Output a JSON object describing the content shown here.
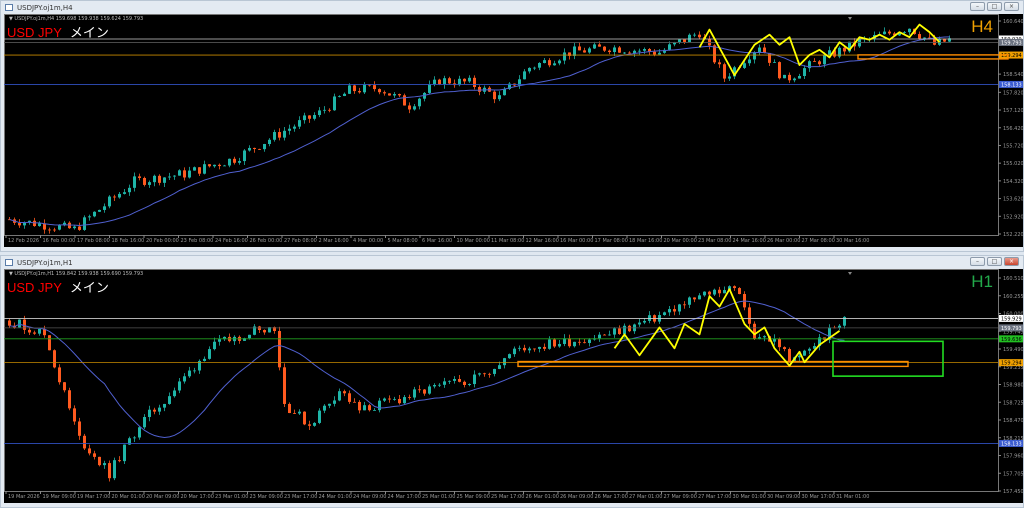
{
  "windows": [
    {
      "title": "USDJPY.oj1m,H4",
      "info": "▼ USDJPY.oj1m,H4  159.698 159.938 159.624 159.793",
      "symbol": "USD JPY",
      "label": "メイン",
      "timeframe": "H4",
      "timeframe_color": "#f0a000",
      "window_buttons": [
        "–",
        "□",
        "×"
      ],
      "price_axis": [
        "160.640",
        "158.540",
        "157.820",
        "157.120",
        "156.420",
        "155.720",
        "155.020",
        "154.320",
        "153.620",
        "152.920",
        "152.220"
      ],
      "price_range": [
        152.22,
        160.64
      ],
      "time_axis": [
        "12 Feb 2026",
        "16 Feb 00:00",
        "17 Feb 08:00",
        "18 Feb 16:00",
        "20 Feb 00:00",
        "23 Feb 08:00",
        "24 Feb 16:00",
        "26 Feb 00:00",
        "27 Feb 08:00",
        "2 Mar 16:00",
        "4 Mar 00:00",
        "5 Mar 08:00",
        "6 Mar 16:00",
        "10 Mar 00:00",
        "11 Mar 08:00",
        "12 Mar 16:00",
        "16 Mar 00:00",
        "17 Mar 08:00",
        "18 Mar 16:00",
        "20 Mar 00:00",
        "23 Mar 08:00",
        "24 Mar 16:00",
        "26 Mar 00:00",
        "27 Mar 08:00",
        "30 Mar 16:00"
      ],
      "hlines": [
        {
          "price": 159.929,
          "label": "159.929",
          "color": "#cccccc",
          "tag_bg": "#ffffff",
          "tag_fg": "#000"
        },
        {
          "price": 159.793,
          "label": "159.793",
          "color": "#555555",
          "tag_bg": "#6b7280",
          "tag_fg": "#fff"
        },
        {
          "price": 159.294,
          "label": "159.294",
          "color": "#c88a00",
          "tag_bg": "#f0a000",
          "tag_fg": "#000"
        },
        {
          "price": 158.133,
          "label": "158.133",
          "color": "#3050c0",
          "tag_bg": "#3a5bd0",
          "tag_fg": "#fff"
        }
      ],
      "price_path": [
        [
          0,
          152.8
        ],
        [
          13,
          152.4
        ],
        [
          25,
          154.3
        ],
        [
          35,
          154.6
        ],
        [
          45,
          155.2
        ],
        [
          55,
          156.3
        ],
        [
          62,
          157.0
        ],
        [
          68,
          157.9
        ],
        [
          74,
          158.0
        ],
        [
          80,
          157.3
        ],
        [
          86,
          158.3
        ],
        [
          92,
          158.2
        ],
        [
          98,
          157.6
        ],
        [
          104,
          158.8
        ],
        [
          112,
          159.4
        ],
        [
          120,
          159.6
        ],
        [
          130,
          159.4
        ],
        [
          138,
          160.2
        ],
        [
          143,
          158.4
        ],
        [
          150,
          159.7
        ],
        [
          155,
          158.3
        ],
        [
          163,
          159.2
        ],
        [
          170,
          159.8
        ],
        [
          180,
          160.4
        ],
        [
          185,
          159.7
        ],
        [
          188,
          159.9
        ]
      ],
      "zigzag": [
        [
          138,
          159.6
        ],
        [
          140,
          160.3
        ],
        [
          145,
          158.5
        ],
        [
          149,
          159.7
        ],
        [
          152,
          160.1
        ],
        [
          154,
          159.7
        ],
        [
          156,
          160.0
        ],
        [
          158,
          158.9
        ],
        [
          160,
          159.3
        ],
        [
          162,
          159.5
        ],
        [
          164,
          159.2
        ],
        [
          166,
          159.8
        ],
        [
          168,
          159.5
        ],
        [
          170,
          160.0
        ],
        [
          172,
          159.9
        ],
        [
          174,
          160.1
        ],
        [
          176,
          159.9
        ],
        [
          178,
          160.2
        ],
        [
          180,
          160.0
        ],
        [
          182,
          160.5
        ],
        [
          184,
          160.2
        ],
        [
          186,
          159.8
        ]
      ],
      "zones": [
        {
          "type": "orange",
          "from_candle": 170,
          "to_candle": 200,
          "top": 159.3,
          "bottom": 159.14
        }
      ]
    },
    {
      "title": "USDJPY.oj1m,H1",
      "info": "▼ USDJPY.oj1m,H1  159.842 159.938 159.690 159.793",
      "symbol": "USD JPY",
      "label": "メイン",
      "timeframe": "H1",
      "timeframe_color": "#22a84a",
      "window_buttons": [
        "–",
        "□",
        "×"
      ],
      "price_axis": [
        "160.510",
        "160.255",
        "160.000",
        "159.745",
        "159.490",
        "159.235",
        "158.980",
        "158.725",
        "158.470",
        "158.215",
        "157.960",
        "157.705",
        "157.450"
      ],
      "price_range": [
        157.45,
        160.51
      ],
      "time_axis": [
        "19 Mar 2026",
        "19 Mar 09:00",
        "19 Mar 17:00",
        "20 Mar 01:00",
        "20 Mar 09:00",
        "20 Mar 17:00",
        "23 Mar 01:00",
        "23 Mar 09:00",
        "23 Mar 17:00",
        "24 Mar 01:00",
        "24 Mar 09:00",
        "24 Mar 17:00",
        "25 Mar 01:00",
        "25 Mar 09:00",
        "25 Mar 17:00",
        "26 Mar 01:00",
        "26 Mar 09:00",
        "26 Mar 17:00",
        "27 Mar 01:00",
        "27 Mar 09:00",
        "27 Mar 17:00",
        "30 Mar 01:00",
        "30 Mar 09:00",
        "30 Mar 17:00",
        "31 Mar 01:00"
      ],
      "hlines": [
        {
          "price": 159.929,
          "label": "159.929",
          "color": "#cccccc",
          "tag_bg": "#ffffff",
          "tag_fg": "#000"
        },
        {
          "price": 159.793,
          "label": "159.793",
          "color": "#555555",
          "tag_bg": "#6b7280",
          "tag_fg": "#fff"
        },
        {
          "price": 159.636,
          "label": "159.636",
          "color": "#22a020",
          "tag_bg": "#22c022",
          "tag_fg": "#000"
        },
        {
          "price": 159.294,
          "label": "159.294",
          "color": "#c88a00",
          "tag_bg": "#f0a000",
          "tag_fg": "#000"
        },
        {
          "price": 158.133,
          "label": "158.133",
          "color": "#3050c0",
          "tag_bg": "#3a5bd0",
          "tag_fg": "#fff"
        }
      ],
      "price_path": [
        [
          0,
          159.9
        ],
        [
          7,
          159.7
        ],
        [
          14,
          158.2
        ],
        [
          20,
          157.7
        ],
        [
          26,
          158.4
        ],
        [
          33,
          158.9
        ],
        [
          40,
          159.5
        ],
        [
          50,
          159.8
        ],
        [
          53,
          159.8
        ],
        [
          55,
          158.7
        ],
        [
          60,
          158.4
        ],
        [
          66,
          158.9
        ],
        [
          70,
          158.6
        ],
        [
          84,
          158.9
        ],
        [
          94,
          159.1
        ],
        [
          102,
          159.5
        ],
        [
          112,
          159.6
        ],
        [
          120,
          159.7
        ],
        [
          128,
          159.9
        ],
        [
          140,
          160.3
        ],
        [
          145,
          160.4
        ],
        [
          149,
          159.7
        ],
        [
          153,
          159.6
        ],
        [
          157,
          159.3
        ],
        [
          160,
          159.5
        ],
        [
          167,
          159.9
        ]
      ],
      "zigzag": [
        [
          121,
          159.5
        ],
        [
          123,
          159.7
        ],
        [
          126,
          159.4
        ],
        [
          130,
          159.8
        ],
        [
          133,
          159.5
        ],
        [
          135,
          159.85
        ],
        [
          138,
          159.7
        ],
        [
          140,
          160.25
        ],
        [
          142,
          160.1
        ],
        [
          144,
          160.35
        ],
        [
          147,
          159.85
        ],
        [
          149,
          159.7
        ],
        [
          151,
          159.8
        ],
        [
          153,
          159.5
        ],
        [
          156,
          159.25
        ],
        [
          158,
          159.45
        ],
        [
          159,
          159.3
        ],
        [
          162,
          159.55
        ],
        [
          164,
          159.65
        ],
        [
          166,
          159.75
        ]
      ],
      "zones": [
        {
          "type": "orange",
          "from_candle": 102,
          "to_candle": 180,
          "top": 159.31,
          "bottom": 159.24
        },
        {
          "type": "green",
          "from_candle": 165,
          "to_candle": 187,
          "top": 159.6,
          "bottom": 159.1
        }
      ]
    }
  ],
  "colors": {
    "bull": "#1fb5a8",
    "bear": "#ff5a1f",
    "ma": "#5060d0",
    "zigzag": "#ffff00",
    "orange_zone": "#ff8c00",
    "green_zone": "#22dd22"
  }
}
